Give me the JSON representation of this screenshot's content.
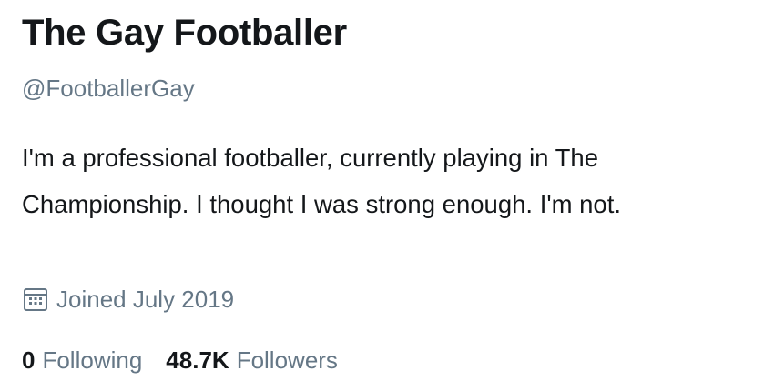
{
  "profile": {
    "display_name": "The Gay Footballer",
    "handle": "@FootballerGay",
    "bio": "I'm a professional footballer, currently playing in The Championship. I thought I was strong enough. I'm not.",
    "joined": {
      "icon": "calendar-icon",
      "text": "Joined July 2019"
    },
    "stats": {
      "following": {
        "count": "0",
        "label": "Following"
      },
      "followers": {
        "count": "48.7K",
        "label": "Followers"
      }
    }
  },
  "colors": {
    "primary_text": "#14171a",
    "secondary_text": "#657786",
    "background": "#ffffff"
  }
}
